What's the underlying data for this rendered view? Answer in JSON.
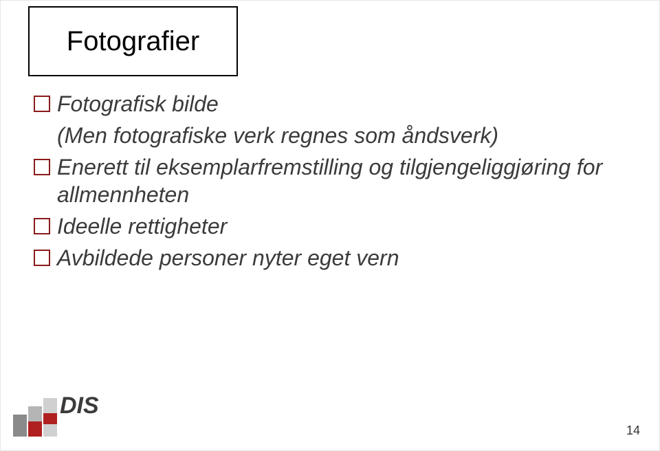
{
  "slide": {
    "title": "Fotografier",
    "bullets": [
      {
        "line1": "Fotografisk bilde",
        "line2": "(Men fotografiske verk regnes som åndsverk)"
      },
      {
        "line1": "Enerett til eksemplarfremstilling og tilgjengeliggjøring for allmennheten"
      },
      {
        "line1": "Ideelle rettigheter"
      },
      {
        "line1": "Avbildede personer nyter eget vern"
      }
    ],
    "pageNumber": "14",
    "logoText": "DIS",
    "colors": {
      "bulletBorder": "#8b1a1a",
      "text": "#3b3b3b",
      "logoRed": "#b02020",
      "logoGray1": "#8a8a8a",
      "logoGray2": "#b5b5b5",
      "logoGray3": "#d0d0d0"
    }
  }
}
